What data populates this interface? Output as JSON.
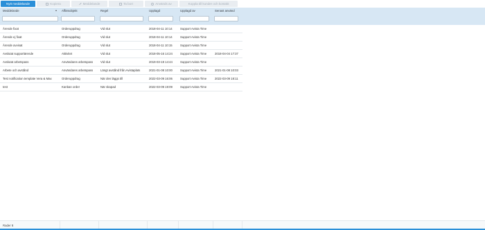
{
  "toolbar": {
    "new_message": "Nytt meddelande",
    "copy": "Kopiera",
    "message": "Meddelande",
    "delete": "Ta bort",
    "used_by": "Används av",
    "connect_customers": "Koppla till kunder och kontakt"
  },
  "table": {
    "columns": [
      "Meddelande",
      "Affärsobjekt",
      "Regel",
      "Upplagd",
      "Upplagd av",
      "Senast använd"
    ],
    "rows": [
      [
        "Ärende fixat",
        "Orderuppdrag",
        "Vid slut",
        "2018-04-11 10:14",
        "Support Avista Time",
        ""
      ],
      [
        "Ärende ej fixat",
        "Orderuppdrag",
        "Vid slut",
        "2018-04-11 10:14",
        "Support Avista Time",
        ""
      ],
      [
        "Ärende avvisat",
        "Orderuppdrag",
        "Vid slut",
        "2018-04-11 10:15",
        "Support Avista Time",
        ""
      ],
      [
        "Avslutat supportärende",
        "Aktivitet",
        "Vid slut",
        "2018-05-16 14:24",
        "Support Avista Time",
        "2018-04-04 17:37"
      ],
      [
        "Avslutat arbetspass",
        "Användares arbetspass",
        "Vid slut",
        "2019-03-19 14:44",
        "Support Avista Time",
        ""
      ],
      [
        "Arbete och avstånd",
        "Användares arbetspass",
        "Längt avstånd från Avistaplats",
        "2021-01-08 10:00",
        "Support Avista Time",
        "2021-01-08 10:03"
      ],
      [
        "Test notification template Vera & Max",
        "Orderuppdrag",
        "När den läggs till",
        "2022-03-09 16:06",
        "Support Avista Time",
        "2022-03-09 18:11"
      ],
      [
        "test",
        "Kanban order",
        "När skapad",
        "2022-03-09 19:09",
        "Support Avista Time",
        ""
      ]
    ]
  },
  "footer": {
    "rows_label": "Rader 8"
  },
  "colors": {
    "accent": "#2b8fd8",
    "header_bg": "#d7e7f4"
  }
}
